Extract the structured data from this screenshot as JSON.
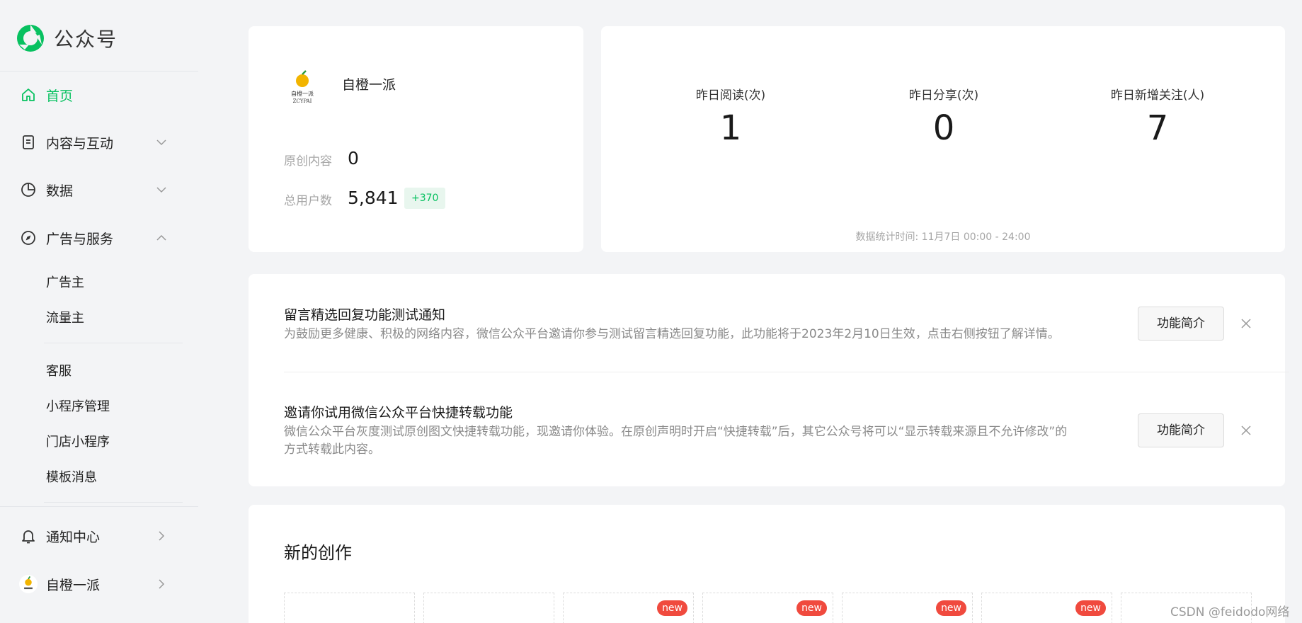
{
  "brand": {
    "name": "公众号",
    "accent": "#07c160"
  },
  "nav": {
    "home": "首页",
    "content": "内容与互动",
    "data": "数据",
    "ads": "广告与服务",
    "ads_sub": [
      "广告主",
      "流量主"
    ],
    "services": [
      "客服",
      "小程序管理",
      "门店小程序",
      "模板消息"
    ],
    "notify": "通知中心",
    "account": "自橙一派"
  },
  "account_card": {
    "name": "自橙一派",
    "avatar_text": "自橙一派",
    "avatar_sub": "ZCYPAI",
    "original_label": "原创内容",
    "original_value": "0",
    "users_label": "总用户数",
    "users_value": "5,841",
    "users_delta": "+370"
  },
  "metrics": {
    "items": [
      {
        "label": "昨日阅读(次)",
        "value": "1"
      },
      {
        "label": "昨日分享(次)",
        "value": "0"
      },
      {
        "label": "昨日新增关注(人)",
        "value": "7"
      }
    ],
    "note": "数据统计时间: 11月7日 00:00 - 24:00"
  },
  "notices": [
    {
      "title": "留言精选回复功能测试通知",
      "desc": "为鼓励更多健康、积极的网络内容，微信公众平台邀请你参与测试留言精选回复功能，此功能将于2023年2月10日生效，点击右侧按钮了解详情。",
      "button": "功能简介"
    },
    {
      "title": "邀请你试用微信公众平台快捷转载功能",
      "desc": "微信公众平台灰度测试原创图文快捷转载功能，现邀请你体验。在原创声明时开启“快捷转载”后，其它公众号将可以“显示转载来源且不允许修改”的方式转载此内容。",
      "button": "功能简介"
    }
  ],
  "create": {
    "title": "新的创作",
    "tiles": [
      {
        "badge": ""
      },
      {
        "badge": ""
      },
      {
        "badge": "new"
      },
      {
        "badge": "new"
      },
      {
        "badge": "new"
      },
      {
        "badge": "new"
      },
      {
        "badge": ""
      }
    ]
  },
  "watermark": "CSDN @feidodo网络"
}
